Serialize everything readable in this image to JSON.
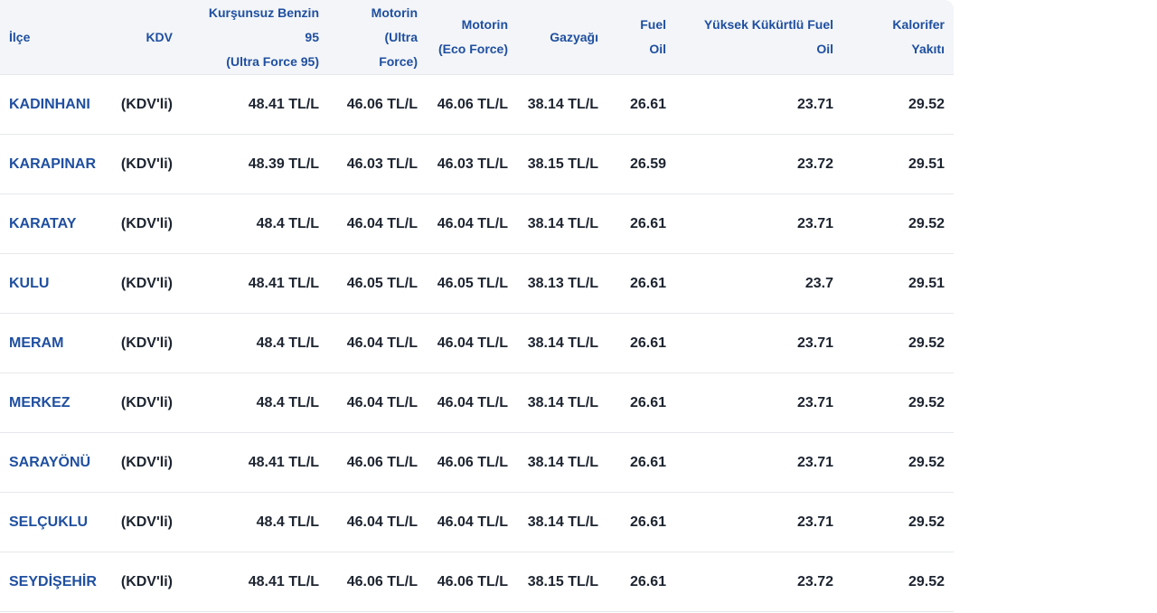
{
  "table": {
    "headers": {
      "ilce": "İlçe",
      "kdv": "KDV",
      "kursunsuz_1": "Kurşunsuz Benzin",
      "kursunsuz_2": "95",
      "kursunsuz_3": "(Ultra Force 95)",
      "motorin_ultra_1": "Motorin",
      "motorin_ultra_2": "(Ultra",
      "motorin_ultra_3": "Force)",
      "motorin_eco_1": "Motorin",
      "motorin_eco_2": "(Eco Force)",
      "gazyagi": "Gazyağı",
      "fuel_oil_1": "Fuel",
      "fuel_oil_2": "Oil",
      "yuksek_1": "Yüksek Kükürtlü Fuel",
      "yuksek_2": "Oil",
      "kalorifer_1": "Kalorifer",
      "kalorifer_2": "Yakıtı"
    },
    "rows": [
      {
        "ilce": "KADINHANI",
        "kdv": "(KDV'li)",
        "kursunsuz": "48.41 TL/L",
        "motorin_ultra": "46.06 TL/L",
        "motorin_eco": "46.06 TL/L",
        "gazyagi": "38.14 TL/L",
        "fuel_oil": "26.61",
        "yuksek": "23.71",
        "kalorifer": "29.52"
      },
      {
        "ilce": "KARAPINAR",
        "kdv": "(KDV'li)",
        "kursunsuz": "48.39 TL/L",
        "motorin_ultra": "46.03 TL/L",
        "motorin_eco": "46.03 TL/L",
        "gazyagi": "38.15 TL/L",
        "fuel_oil": "26.59",
        "yuksek": "23.72",
        "kalorifer": "29.51"
      },
      {
        "ilce": "KARATAY",
        "kdv": "(KDV'li)",
        "kursunsuz": "48.4 TL/L",
        "motorin_ultra": "46.04 TL/L",
        "motorin_eco": "46.04 TL/L",
        "gazyagi": "38.14 TL/L",
        "fuel_oil": "26.61",
        "yuksek": "23.71",
        "kalorifer": "29.52"
      },
      {
        "ilce": "KULU",
        "kdv": "(KDV'li)",
        "kursunsuz": "48.41 TL/L",
        "motorin_ultra": "46.05 TL/L",
        "motorin_eco": "46.05 TL/L",
        "gazyagi": "38.13 TL/L",
        "fuel_oil": "26.61",
        "yuksek": "23.7",
        "kalorifer": "29.51"
      },
      {
        "ilce": "MERAM",
        "kdv": "(KDV'li)",
        "kursunsuz": "48.4 TL/L",
        "motorin_ultra": "46.04 TL/L",
        "motorin_eco": "46.04 TL/L",
        "gazyagi": "38.14 TL/L",
        "fuel_oil": "26.61",
        "yuksek": "23.71",
        "kalorifer": "29.52"
      },
      {
        "ilce": "MERKEZ",
        "kdv": "(KDV'li)",
        "kursunsuz": "48.4 TL/L",
        "motorin_ultra": "46.04 TL/L",
        "motorin_eco": "46.04 TL/L",
        "gazyagi": "38.14 TL/L",
        "fuel_oil": "26.61",
        "yuksek": "23.71",
        "kalorifer": "29.52"
      },
      {
        "ilce": "SARAYÖNÜ",
        "kdv": "(KDV'li)",
        "kursunsuz": "48.41 TL/L",
        "motorin_ultra": "46.06 TL/L",
        "motorin_eco": "46.06 TL/L",
        "gazyagi": "38.14 TL/L",
        "fuel_oil": "26.61",
        "yuksek": "23.71",
        "kalorifer": "29.52"
      },
      {
        "ilce": "SELÇUKLU",
        "kdv": "(KDV'li)",
        "kursunsuz": "48.4 TL/L",
        "motorin_ultra": "46.04 TL/L",
        "motorin_eco": "46.04 TL/L",
        "gazyagi": "38.14 TL/L",
        "fuel_oil": "26.61",
        "yuksek": "23.71",
        "kalorifer": "29.52"
      },
      {
        "ilce": "SEYDİŞEHİR",
        "kdv": "(KDV'li)",
        "kursunsuz": "48.41 TL/L",
        "motorin_ultra": "46.06 TL/L",
        "motorin_eco": "46.06 TL/L",
        "gazyagi": "38.15 TL/L",
        "fuel_oil": "26.61",
        "yuksek": "23.72",
        "kalorifer": "29.52"
      }
    ]
  }
}
